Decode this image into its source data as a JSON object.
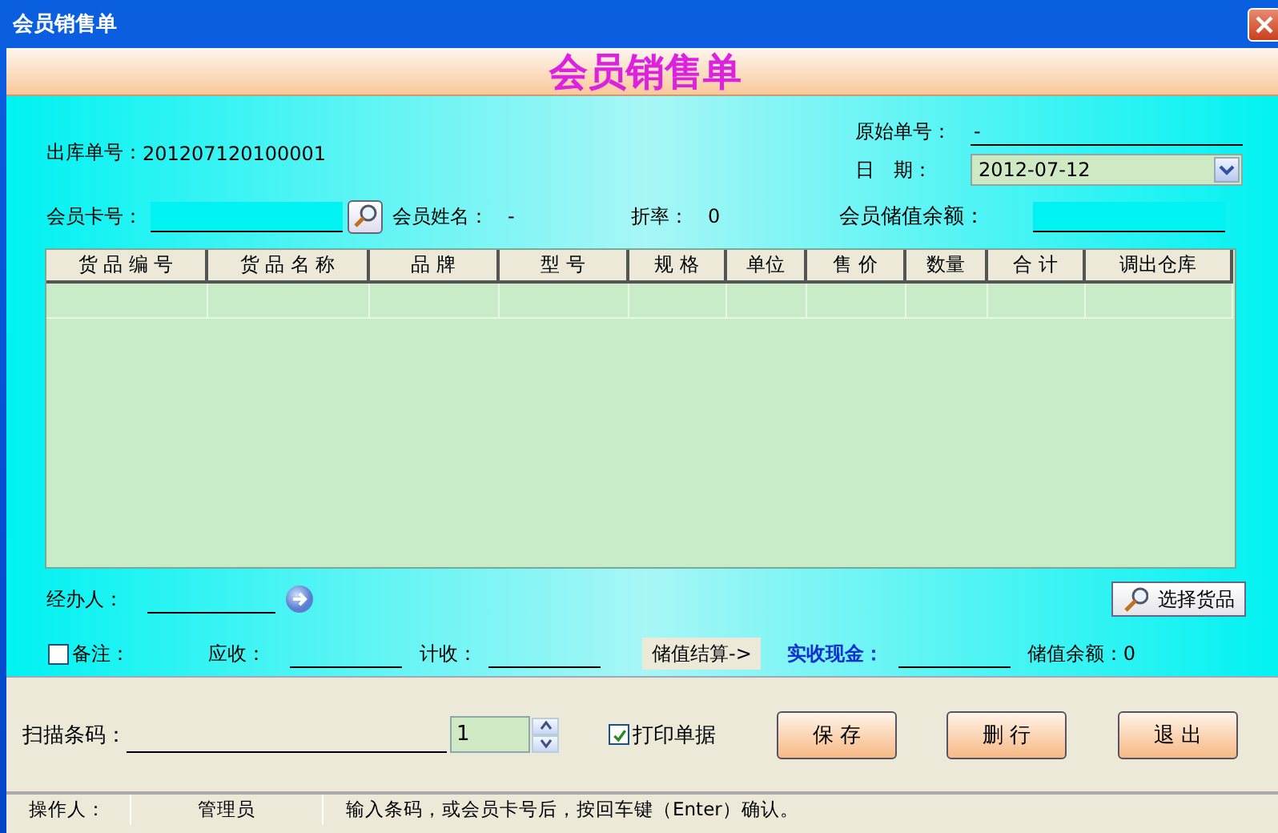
{
  "window": {
    "title": "会员销售单"
  },
  "banner": "会员销售单",
  "outbound_no": {
    "label": "出库单号：",
    "value": "201207120100001"
  },
  "original_no": {
    "label": "原始单号：",
    "value": "-"
  },
  "date": {
    "label": "日　期：",
    "value": "2012-07-12"
  },
  "member_card": {
    "label": "会员卡号："
  },
  "member_name": {
    "label": "会员姓名：",
    "value": "-"
  },
  "discount": {
    "label": "折率：",
    "value": "0"
  },
  "member_balance": {
    "label": "会员储值余额："
  },
  "table": {
    "columns": [
      "货 品 编 号",
      "货 品 名 称",
      "品 牌",
      "型 号",
      "规 格",
      "单位",
      "售 价",
      "数量",
      "合 计",
      "调出仓库"
    ]
  },
  "handler": {
    "label": "经办人："
  },
  "select_goods_button": "选择货品",
  "note": {
    "label": "备注：",
    "checked": false
  },
  "receivable": {
    "label": "应收："
  },
  "counted": {
    "label": "计收："
  },
  "stored_settle_button": "储值结算->",
  "cash_received": {
    "label": "实收现金："
  },
  "stored_balance": {
    "label": "储值余额：",
    "value": "0"
  },
  "barcode": {
    "label": "扫描条码："
  },
  "quantity": {
    "value": "1"
  },
  "print_receipt": {
    "label": "打印单据",
    "checked": true
  },
  "buttons": [
    {
      "label": "保 存"
    },
    {
      "label": "删 行"
    },
    {
      "label": "退 出"
    }
  ],
  "status_bar": [
    "操作人：",
    "管理员",
    "输入条码，或会员卡号后，按回车键（Enter）确认。"
  ]
}
